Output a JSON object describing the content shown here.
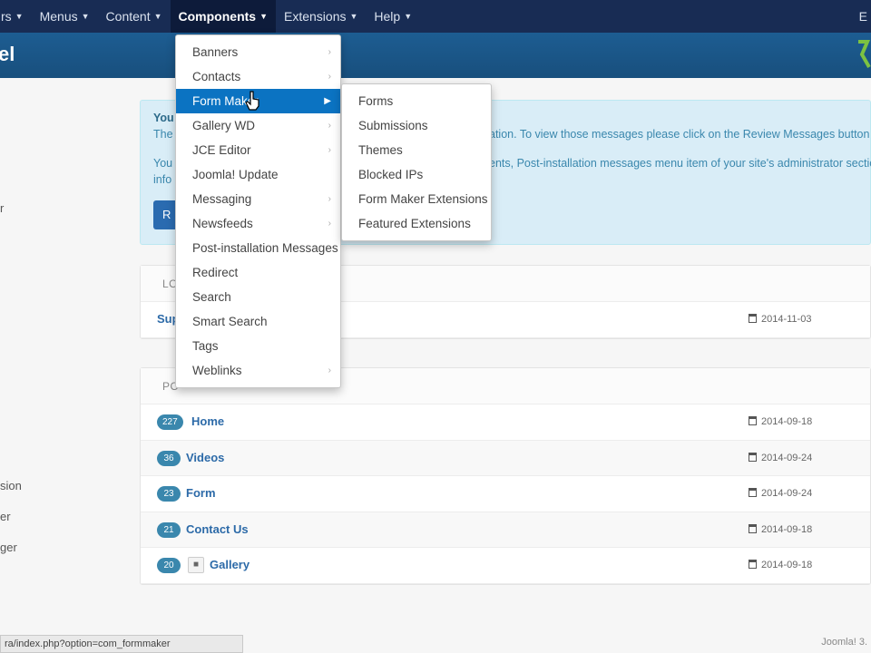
{
  "topnav": {
    "items": [
      {
        "label": "rs",
        "active": false
      },
      {
        "label": "Menus",
        "active": false
      },
      {
        "label": "Content",
        "active": false
      },
      {
        "label": "Components",
        "active": true
      },
      {
        "label": "Extensions",
        "active": false
      },
      {
        "label": "Help",
        "active": false
      }
    ],
    "right_label": "E"
  },
  "header": {
    "title": "el"
  },
  "sidebar": {
    "fragments": [
      "r",
      "sion",
      "er",
      "ger"
    ]
  },
  "alert": {
    "line1": "You",
    "line2": "The",
    "line2_end": "ation. To view those messages please click on the Review Messages button b",
    "line3": "You",
    "line3_end": "ents, Post-installation messages menu item of your site's administrator sectio",
    "line4": "info",
    "button": "R"
  },
  "logged_panel": {
    "header": "LO",
    "rows": [
      {
        "name": "Sup",
        "date": "2014-11-03"
      }
    ]
  },
  "popular_panel": {
    "header": "PO",
    "rows": [
      {
        "count": "227",
        "name": "Home",
        "date": "2014-09-18",
        "locked": false
      },
      {
        "count": "36",
        "name": "Videos",
        "date": "2014-09-24",
        "locked": false
      },
      {
        "count": "23",
        "name": "Form",
        "date": "2014-09-24",
        "locked": false
      },
      {
        "count": "21",
        "name": "Contact Us",
        "date": "2014-09-18",
        "locked": false
      },
      {
        "count": "20",
        "name": "Gallery",
        "date": "2014-09-18",
        "locked": true
      }
    ]
  },
  "components_menu": {
    "items": [
      {
        "label": "Banners",
        "submenu": true
      },
      {
        "label": "Contacts",
        "submenu": true
      },
      {
        "label": "Form Maker",
        "submenu": true,
        "active": true
      },
      {
        "label": "Gallery WD",
        "submenu": true
      },
      {
        "label": "JCE Editor",
        "submenu": true
      },
      {
        "label": "Joomla! Update",
        "submenu": false
      },
      {
        "label": "Messaging",
        "submenu": true
      },
      {
        "label": "Newsfeeds",
        "submenu": true
      },
      {
        "label": "Post-installation Messages",
        "submenu": false
      },
      {
        "label": "Redirect",
        "submenu": false
      },
      {
        "label": "Search",
        "submenu": false
      },
      {
        "label": "Smart Search",
        "submenu": false
      },
      {
        "label": "Tags",
        "submenu": false
      },
      {
        "label": "Weblinks",
        "submenu": true
      }
    ]
  },
  "formmaker_menu": {
    "items": [
      "Forms",
      "Submissions",
      "Themes",
      "Blocked IPs",
      "Form Maker Extensions",
      "Featured Extensions"
    ]
  },
  "statusbar": {
    "url": "ra/index.php?option=com_formmaker"
  },
  "footer": {
    "right": "Joomla! 3."
  },
  "colors": {
    "topnav": "#182c54",
    "header": "#1d5d92",
    "menu_active": "#0b73c2",
    "badge": "#3a87ad"
  }
}
